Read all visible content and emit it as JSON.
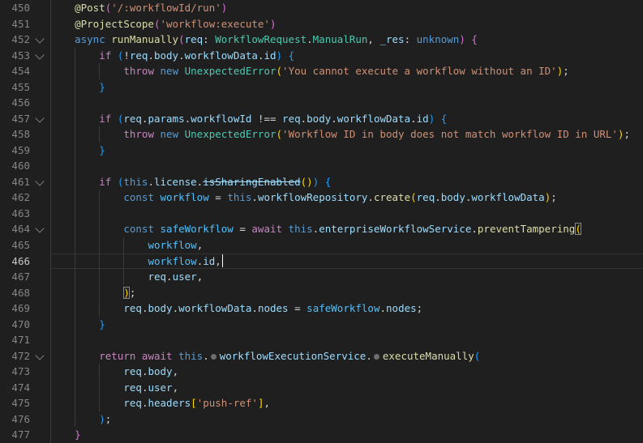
{
  "palette": {
    "bg": "#1f1f1f",
    "gutter": "#858585",
    "gutterActive": "#c6c6c6",
    "chevron": "#7d7d7d",
    "guide": "#3a3a3a",
    "linehl": "#343434",
    "kw": "#569CD6",
    "ctrl": "#C586C0",
    "fn": "#DCDCAA",
    "type": "#4EC9B0",
    "var": "#9CDCFE",
    "cvar": "#4FC1FF",
    "str": "#CE9178",
    "pun": "#d4d4d4",
    "b1": "#FFD700",
    "b2": "#DA70D6",
    "b3": "#179FFF",
    "bracketMatch": "#888888",
    "dot": "#6e6e6e",
    "cursor": "#ffffff"
  },
  "editor": {
    "char_width": 7.53,
    "lines": [
      {
        "n": 450,
        "ind": 4,
        "guides": [
          0
        ],
        "tokens": [
          [
            "@Post",
            "fn"
          ],
          [
            "(",
            "b2"
          ],
          [
            "'/:workflowId/run'",
            "str"
          ],
          [
            ")",
            "b2"
          ]
        ]
      },
      {
        "n": 451,
        "ind": 4,
        "guides": [
          0
        ],
        "tokens": [
          [
            "@ProjectScope",
            "fn"
          ],
          [
            "(",
            "b2"
          ],
          [
            "'workflow:execute'",
            "str"
          ],
          [
            ")",
            "b2"
          ]
        ]
      },
      {
        "n": 452,
        "ind": 4,
        "fold": true,
        "guides": [
          0
        ],
        "tokens": [
          [
            "async ",
            "kw"
          ],
          [
            "runManually",
            "fn"
          ],
          [
            "(",
            "b2"
          ],
          [
            "req",
            "var"
          ],
          [
            ": ",
            "pun"
          ],
          [
            "WorkflowRequest",
            "type"
          ],
          [
            ".",
            "pun"
          ],
          [
            "ManualRun",
            "type"
          ],
          [
            ", ",
            "pun"
          ],
          [
            "_res",
            "var"
          ],
          [
            ": ",
            "pun"
          ],
          [
            "unknown",
            "kw"
          ],
          [
            ") ",
            "b2"
          ],
          [
            "{",
            "b2"
          ]
        ]
      },
      {
        "n": 453,
        "ind": 8,
        "fold": true,
        "guides": [
          0,
          4
        ],
        "tokens": [
          [
            "if ",
            "ctrl"
          ],
          [
            "(",
            "b3"
          ],
          [
            "!",
            "pun"
          ],
          [
            "req",
            "var"
          ],
          [
            ".",
            "pun"
          ],
          [
            "body",
            "var"
          ],
          [
            ".",
            "pun"
          ],
          [
            "workflowData",
            "var"
          ],
          [
            ".",
            "pun"
          ],
          [
            "id",
            "var"
          ],
          [
            ") ",
            "b3"
          ],
          [
            "{",
            "b3"
          ]
        ]
      },
      {
        "n": 454,
        "ind": 12,
        "guides": [
          0,
          4,
          8
        ],
        "tokens": [
          [
            "throw ",
            "ctrl"
          ],
          [
            "new ",
            "kw"
          ],
          [
            "UnexpectedError",
            "type"
          ],
          [
            "(",
            "b1"
          ],
          [
            "'You cannot execute a workflow without an ID'",
            "str"
          ],
          [
            ")",
            "b1"
          ],
          [
            ";",
            "pun"
          ]
        ]
      },
      {
        "n": 455,
        "ind": 8,
        "guides": [
          0,
          4
        ],
        "tokens": [
          [
            "}",
            "b3"
          ]
        ]
      },
      {
        "n": 456,
        "ind": 0,
        "guides": [
          0,
          4
        ],
        "tokens": []
      },
      {
        "n": 457,
        "ind": 8,
        "fold": true,
        "guides": [
          0,
          4
        ],
        "tokens": [
          [
            "if ",
            "ctrl"
          ],
          [
            "(",
            "b3"
          ],
          [
            "req",
            "var"
          ],
          [
            ".",
            "pun"
          ],
          [
            "params",
            "var"
          ],
          [
            ".",
            "pun"
          ],
          [
            "workflowId",
            "var"
          ],
          [
            " !== ",
            "pun"
          ],
          [
            "req",
            "var"
          ],
          [
            ".",
            "pun"
          ],
          [
            "body",
            "var"
          ],
          [
            ".",
            "pun"
          ],
          [
            "workflowData",
            "var"
          ],
          [
            ".",
            "pun"
          ],
          [
            "id",
            "var"
          ],
          [
            ") ",
            "b3"
          ],
          [
            "{",
            "b3"
          ]
        ]
      },
      {
        "n": 458,
        "ind": 12,
        "guides": [
          0,
          4,
          8
        ],
        "tokens": [
          [
            "throw ",
            "ctrl"
          ],
          [
            "new ",
            "kw"
          ],
          [
            "UnexpectedError",
            "type"
          ],
          [
            "(",
            "b1"
          ],
          [
            "'Workflow ID in body does not match workflow ID in URL'",
            "str"
          ],
          [
            ")",
            "b1"
          ],
          [
            ";",
            "pun"
          ]
        ]
      },
      {
        "n": 459,
        "ind": 8,
        "guides": [
          0,
          4
        ],
        "tokens": [
          [
            "}",
            "b3"
          ]
        ]
      },
      {
        "n": 460,
        "ind": 0,
        "guides": [
          0,
          4
        ],
        "tokens": []
      },
      {
        "n": 461,
        "ind": 8,
        "fold": true,
        "guides": [
          0,
          4
        ],
        "tokens": [
          [
            "if ",
            "ctrl"
          ],
          [
            "(",
            "b3"
          ],
          [
            "this",
            "kw"
          ],
          [
            ".",
            "pun"
          ],
          [
            "license",
            "var"
          ],
          [
            ".",
            "pun"
          ],
          [
            "isSharingEnabled",
            "strike"
          ],
          [
            "(",
            "b1"
          ],
          [
            ")",
            "b1"
          ],
          [
            ") ",
            "b3"
          ],
          [
            "{",
            "b3"
          ]
        ]
      },
      {
        "n": 462,
        "ind": 12,
        "guides": [
          0,
          4,
          8
        ],
        "tokens": [
          [
            "const ",
            "kw"
          ],
          [
            "workflow",
            "cvar"
          ],
          [
            " = ",
            "pun"
          ],
          [
            "this",
            "kw"
          ],
          [
            ".",
            "pun"
          ],
          [
            "workflowRepository",
            "var"
          ],
          [
            ".",
            "pun"
          ],
          [
            "create",
            "fn"
          ],
          [
            "(",
            "b1"
          ],
          [
            "req",
            "var"
          ],
          [
            ".",
            "pun"
          ],
          [
            "body",
            "var"
          ],
          [
            ".",
            "pun"
          ],
          [
            "workflowData",
            "var"
          ],
          [
            ")",
            "b1"
          ],
          [
            ";",
            "pun"
          ]
        ]
      },
      {
        "n": 463,
        "ind": 0,
        "guides": [
          0,
          4,
          8
        ],
        "tokens": []
      },
      {
        "n": 464,
        "ind": 12,
        "fold": true,
        "guides": [
          0,
          4,
          8
        ],
        "tokens": [
          [
            "const ",
            "kw"
          ],
          [
            "safeWorkflow",
            "cvar"
          ],
          [
            " = ",
            "pun"
          ],
          [
            "await ",
            "ctrl"
          ],
          [
            "this",
            "kw"
          ],
          [
            ".",
            "pun"
          ],
          [
            "enterpriseWorkflowService",
            "var"
          ],
          [
            ".",
            "pun"
          ],
          [
            "preventTampering",
            "fn"
          ],
          [
            "(",
            "b1 boxed"
          ]
        ]
      },
      {
        "n": 465,
        "ind": 16,
        "guides": [
          0,
          4,
          8,
          12
        ],
        "tokens": [
          [
            "workflow",
            "cvar"
          ],
          [
            ",",
            "pun"
          ]
        ]
      },
      {
        "n": 466,
        "ind": 16,
        "active": true,
        "cursor": true,
        "guides": [
          0,
          4,
          8,
          12
        ],
        "tokens": [
          [
            "workflow",
            "cvar"
          ],
          [
            ".",
            "pun"
          ],
          [
            "id",
            "var"
          ],
          [
            ",",
            "pun"
          ]
        ]
      },
      {
        "n": 467,
        "ind": 16,
        "guides": [
          0,
          4,
          8,
          12
        ],
        "tokens": [
          [
            "req",
            "var"
          ],
          [
            ".",
            "pun"
          ],
          [
            "user",
            "var"
          ],
          [
            ",",
            "pun"
          ]
        ]
      },
      {
        "n": 468,
        "ind": 12,
        "guides": [
          0,
          4,
          8
        ],
        "tokens": [
          [
            ")",
            "b1 boxed"
          ],
          [
            ";",
            "pun"
          ]
        ]
      },
      {
        "n": 469,
        "ind": 12,
        "guides": [
          0,
          4,
          8
        ],
        "tokens": [
          [
            "req",
            "var"
          ],
          [
            ".",
            "pun"
          ],
          [
            "body",
            "var"
          ],
          [
            ".",
            "pun"
          ],
          [
            "workflowData",
            "var"
          ],
          [
            ".",
            "pun"
          ],
          [
            "nodes",
            "var"
          ],
          [
            " = ",
            "pun"
          ],
          [
            "safeWorkflow",
            "cvar"
          ],
          [
            ".",
            "pun"
          ],
          [
            "nodes",
            "var"
          ],
          [
            ";",
            "pun"
          ]
        ]
      },
      {
        "n": 470,
        "ind": 8,
        "guides": [
          0,
          4
        ],
        "tokens": [
          [
            "}",
            "b3"
          ]
        ]
      },
      {
        "n": 471,
        "ind": 0,
        "guides": [
          0,
          4
        ],
        "tokens": []
      },
      {
        "n": 472,
        "ind": 8,
        "fold": true,
        "guides": [
          0,
          4
        ],
        "tokens": [
          [
            "return ",
            "ctrl"
          ],
          [
            "await ",
            "ctrl"
          ],
          [
            "this",
            "kw"
          ],
          [
            ".",
            "pun"
          ],
          [
            "",
            "dot"
          ],
          [
            "workflowExecutionService",
            "var"
          ],
          [
            ".",
            "pun"
          ],
          [
            "",
            "dot"
          ],
          [
            "executeManually",
            "fn"
          ],
          [
            "(",
            "b3"
          ]
        ]
      },
      {
        "n": 473,
        "ind": 12,
        "guides": [
          0,
          4,
          8
        ],
        "tokens": [
          [
            "req",
            "var"
          ],
          [
            ".",
            "pun"
          ],
          [
            "body",
            "var"
          ],
          [
            ",",
            "pun"
          ]
        ]
      },
      {
        "n": 474,
        "ind": 12,
        "guides": [
          0,
          4,
          8
        ],
        "tokens": [
          [
            "req",
            "var"
          ],
          [
            ".",
            "pun"
          ],
          [
            "user",
            "var"
          ],
          [
            ",",
            "pun"
          ]
        ]
      },
      {
        "n": 475,
        "ind": 12,
        "guides": [
          0,
          4,
          8
        ],
        "tokens": [
          [
            "req",
            "var"
          ],
          [
            ".",
            "pun"
          ],
          [
            "headers",
            "var"
          ],
          [
            "[",
            "b1"
          ],
          [
            "'push-ref'",
            "str"
          ],
          [
            "]",
            "b1"
          ],
          [
            ",",
            "pun"
          ]
        ]
      },
      {
        "n": 476,
        "ind": 8,
        "guides": [
          0,
          4
        ],
        "tokens": [
          [
            ")",
            "b3"
          ],
          [
            ";",
            "pun"
          ]
        ]
      },
      {
        "n": 477,
        "ind": 4,
        "guides": [
          0
        ],
        "tokens": [
          [
            "}",
            "b2"
          ]
        ]
      }
    ]
  }
}
